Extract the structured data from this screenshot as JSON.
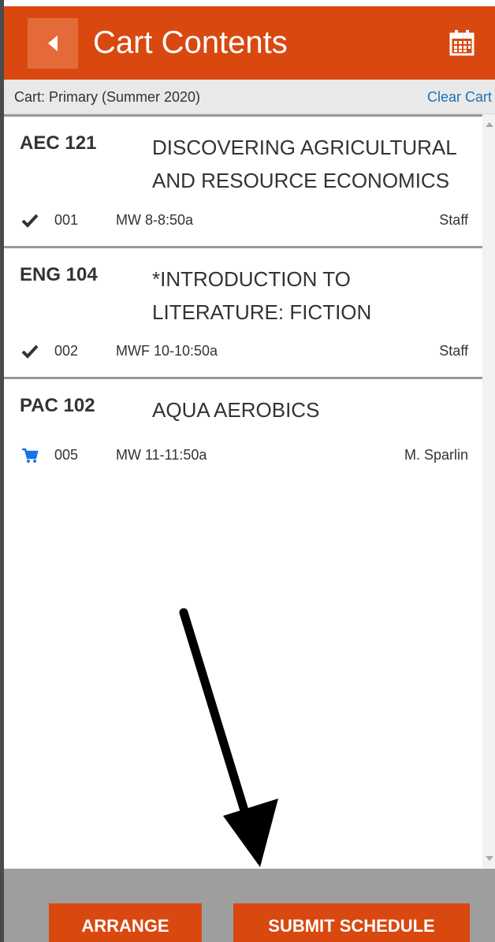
{
  "header": {
    "title": "Cart Contents",
    "back_icon": "caret-left-icon",
    "calendar_icon": "calendar-icon"
  },
  "cartbar": {
    "cart_label": "Cart: Primary (Summer 2020)",
    "clear_label": "Clear Cart"
  },
  "courses": [
    {
      "code": "AEC 121",
      "name": "DISCOVERING AGRICULTURAL AND RESOURCE ECONOMICS",
      "status_icon": "check-icon",
      "section": "001",
      "time": "MW 8-8:50a",
      "instructor": "Staff"
    },
    {
      "code": "ENG 104",
      "name": "*INTRODUCTION TO LITERATURE: FICTION",
      "status_icon": "check-icon",
      "section": "002",
      "time": "MWF 10-10:50a",
      "instructor": "Staff"
    },
    {
      "code": "PAC 102",
      "name": "AQUA AEROBICS",
      "status_icon": "cart-icon",
      "section": "005",
      "time": "MW 11-11:50a",
      "instructor": "M. Sparlin"
    }
  ],
  "footer": {
    "arrange_label": "ARRANGE",
    "submit_label": "SUBMIT SCHEDULE"
  },
  "colors": {
    "accent": "#d9480f",
    "link": "#1a73b8",
    "cart_icon": "#1a73e8"
  }
}
